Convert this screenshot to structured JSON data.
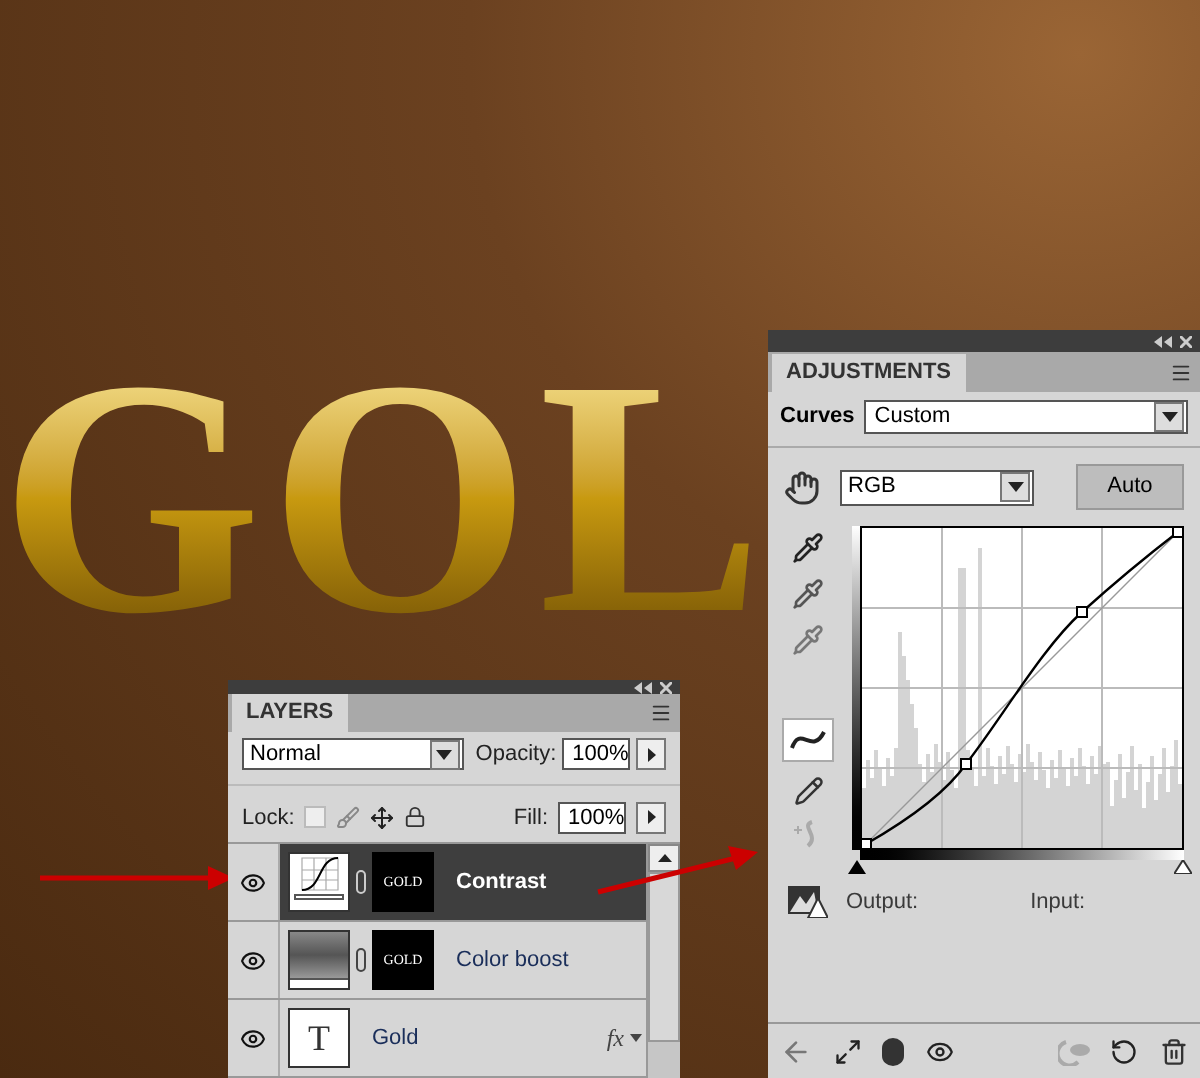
{
  "canvas": {
    "artwork_text": "GOL"
  },
  "layers_panel": {
    "title": "LAYERS",
    "blend_mode": "Normal",
    "opacity_label": "Opacity:",
    "opacity": "100%",
    "lock_label": "Lock:",
    "fill_label": "Fill:",
    "fill": "100%",
    "layers": [
      {
        "kind": "curves",
        "name": "Contrast",
        "selected": true,
        "visible": true,
        "mask_text": "GOLD"
      },
      {
        "kind": "gradient",
        "name": "Color boost",
        "selected": false,
        "visible": true,
        "mask_text": "GOLD"
      },
      {
        "kind": "text",
        "name": "Gold",
        "selected": false,
        "visible": true,
        "thumb_text": "T",
        "fx": "fx"
      }
    ]
  },
  "adjustments_panel": {
    "title": "ADJUSTMENTS",
    "type_label": "Curves",
    "preset": "Custom",
    "channel": "RGB",
    "auto_button": "Auto",
    "output_label": "Output:",
    "input_label": "Input:"
  }
}
